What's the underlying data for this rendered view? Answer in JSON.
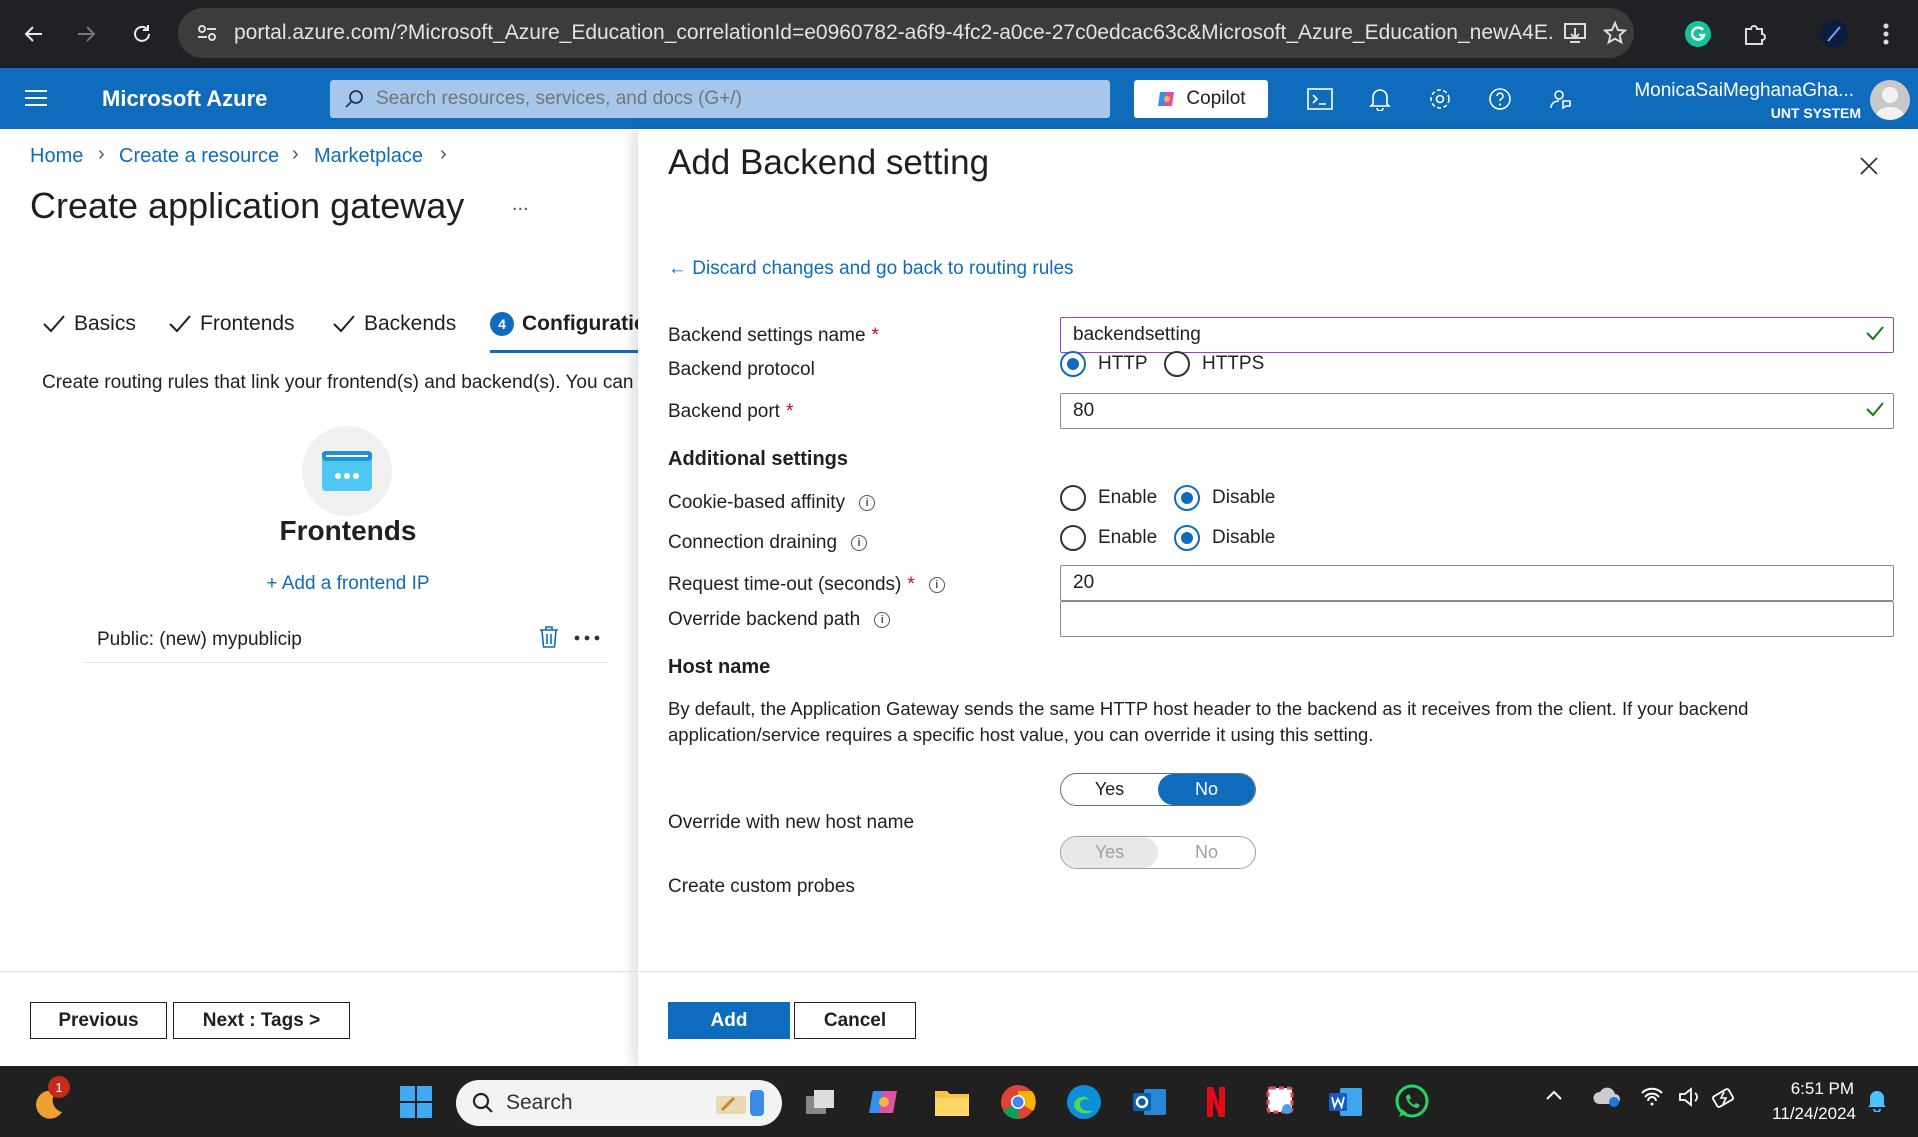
{
  "browser": {
    "url": "portal.azure.com/?Microsoft_Azure_Education_correlationId=e0960782-a6f9-4fc2-a0ce-27c0edcac63c&Microsoft_Azure_Education_newA4E..."
  },
  "header": {
    "brand": "Microsoft Azure",
    "search_placeholder": "Search resources, services, and docs (G+/)",
    "copilot": "Copilot",
    "user_name": "MonicaSaiMeghanaGha...",
    "user_org": "UNT SYSTEM"
  },
  "left": {
    "breadcrumb": [
      "Home",
      "Create a resource",
      "Marketplace"
    ],
    "title": "Create application gateway",
    "more": "...",
    "steps": [
      {
        "label": "Basics",
        "state": "done"
      },
      {
        "label": "Frontends",
        "state": "done"
      },
      {
        "label": "Backends",
        "state": "done"
      },
      {
        "label": "Configuration",
        "number": "4",
        "state": "current"
      }
    ],
    "description": "Create routing rules that link your frontend(s) and backend(s). You can",
    "frontends_title": "Frontends",
    "add_frontend": "+ Add a frontend IP",
    "frontend_item": "Public: (new) mypublicip",
    "previous": "Previous",
    "next": "Next : Tags >"
  },
  "panel": {
    "title": "Add Backend setting",
    "discard": "← Discard changes and go back to routing rules",
    "name_label": "Backend settings name",
    "name_value": "backendsetting",
    "protocol_label": "Backend protocol",
    "protocol_options": [
      "HTTP",
      "HTTPS"
    ],
    "protocol_selected": "HTTP",
    "port_label": "Backend port",
    "port_value": "80",
    "additional": "Additional settings",
    "cookie_label": "Cookie-based affinity",
    "drain_label": "Connection draining",
    "enable": "Enable",
    "disable": "Disable",
    "timeout_label": "Request time-out (seconds)",
    "timeout_value": "20",
    "override_path_label": "Override backend path",
    "override_path_value": "",
    "host_section": "Host name",
    "host_desc": "By default, the Application Gateway sends the same HTTP host header to the backend as it receives from the client. If your backend application/service requires a specific host value, you can override it using this setting.",
    "yes": "Yes",
    "no": "No",
    "override_host_label": "Override with new host name",
    "probes_label": "Create custom probes",
    "add": "Add",
    "cancel": "Cancel"
  },
  "taskbar": {
    "search": "Search",
    "notif_count": "1",
    "time": "6:51 PM",
    "date": "11/24/2024"
  },
  "colors": {
    "azure_blue": "#0f6cbd",
    "chrome_dark": "#202124",
    "taskbar": "#202020",
    "success_green": "#107c10",
    "required_red": "#c50f1f"
  }
}
